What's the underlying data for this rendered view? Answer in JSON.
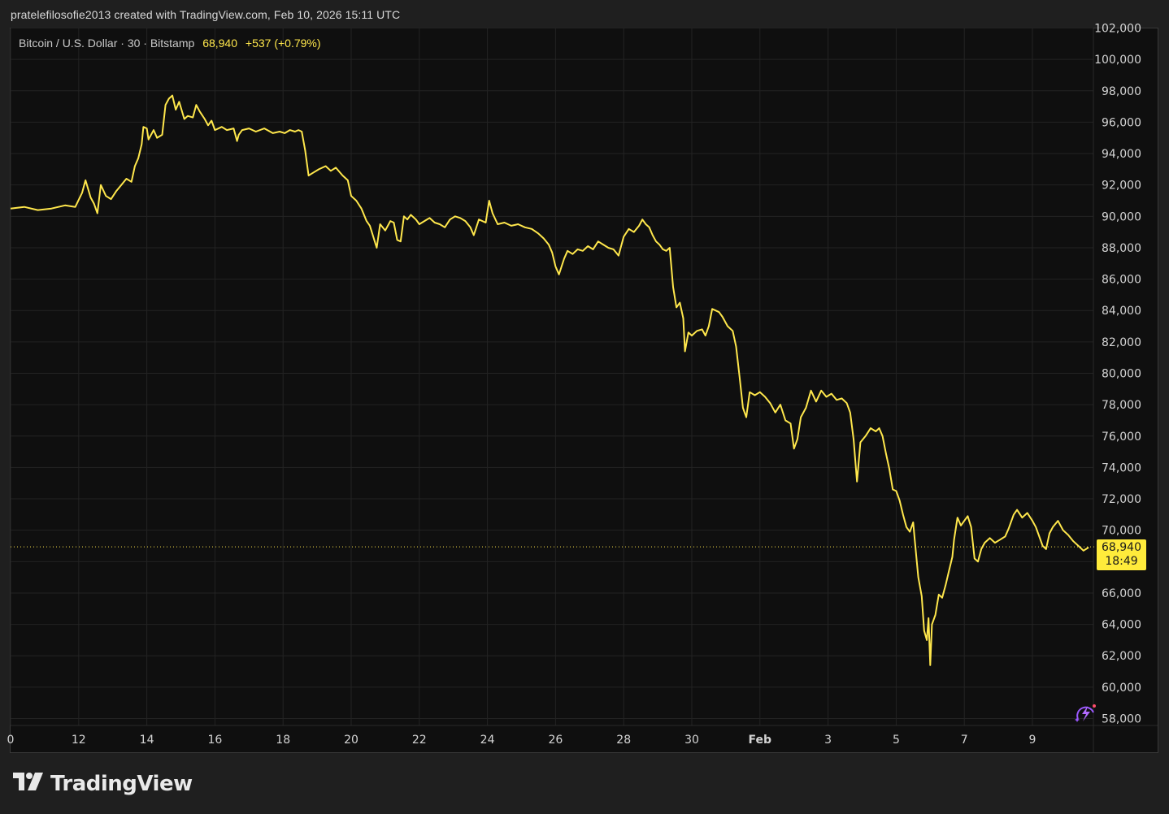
{
  "header": {
    "caption": "pratelefilosofie2013 created with TradingView.com, Feb 10, 2026 15:11 UTC"
  },
  "legend": {
    "symbol": "Bitcoin / U.S. Dollar · 30 · Bitstamp",
    "price": "68,940",
    "change": "+537 (+0.79%)"
  },
  "price_tag": {
    "price": "68,940",
    "countdown": "18:49"
  },
  "branding": {
    "logo_text": "TradingView"
  },
  "colors": {
    "background": "#0f0f0f",
    "grid": "#232323",
    "line": "#ffe74c",
    "axis_text": "#d4d4d4",
    "tag": "#ffeb3b"
  },
  "icons": [
    "tradingview-logo-icon",
    "lightning-icon"
  ],
  "chart_data": {
    "type": "line",
    "title": "",
    "xlabel": "",
    "ylabel": "",
    "ylim": [
      58000,
      102000
    ],
    "grid": true,
    "y_ticks": [
      58000,
      60000,
      62000,
      64000,
      66000,
      68000,
      70000,
      72000,
      74000,
      76000,
      78000,
      80000,
      82000,
      84000,
      86000,
      88000,
      90000,
      92000,
      94000,
      96000,
      98000,
      100000,
      102000
    ],
    "x_ticks": [
      {
        "day": 10,
        "label": "0"
      },
      {
        "day": 12,
        "label": "12"
      },
      {
        "day": 14,
        "label": "14"
      },
      {
        "day": 16,
        "label": "16"
      },
      {
        "day": 18,
        "label": "18"
      },
      {
        "day": 20,
        "label": "20"
      },
      {
        "day": 22,
        "label": "22"
      },
      {
        "day": 24,
        "label": "24"
      },
      {
        "day": 26,
        "label": "26"
      },
      {
        "day": 28,
        "label": "28"
      },
      {
        "day": 30,
        "label": "30"
      },
      {
        "day": 32,
        "label": "Feb"
      },
      {
        "day": 34,
        "label": "3"
      },
      {
        "day": 36,
        "label": "5"
      },
      {
        "day": 38,
        "label": "7"
      },
      {
        "day": 40,
        "label": "9"
      }
    ],
    "x_range": [
      10,
      41.8
    ],
    "last_price": 68940,
    "series": [
      {
        "values": [
          [
            10.0,
            90500
          ],
          [
            10.4,
            90600
          ],
          [
            10.8,
            90400
          ],
          [
            11.2,
            90500
          ],
          [
            11.6,
            90700
          ],
          [
            11.9,
            90600
          ],
          [
            12.1,
            91500
          ],
          [
            12.2,
            92300
          ],
          [
            12.35,
            91200
          ],
          [
            12.45,
            90800
          ],
          [
            12.55,
            90200
          ],
          [
            12.65,
            92000
          ],
          [
            12.8,
            91300
          ],
          [
            12.95,
            91100
          ],
          [
            13.1,
            91600
          ],
          [
            13.25,
            92000
          ],
          [
            13.4,
            92400
          ],
          [
            13.55,
            92200
          ],
          [
            13.65,
            93200
          ],
          [
            13.75,
            93700
          ],
          [
            13.85,
            94600
          ],
          [
            13.9,
            95700
          ],
          [
            14.0,
            95600
          ],
          [
            14.05,
            94900
          ],
          [
            14.2,
            95500
          ],
          [
            14.3,
            95000
          ],
          [
            14.45,
            95200
          ],
          [
            14.55,
            97100
          ],
          [
            14.65,
            97500
          ],
          [
            14.75,
            97700
          ],
          [
            14.85,
            96800
          ],
          [
            14.95,
            97300
          ],
          [
            15.1,
            96200
          ],
          [
            15.2,
            96400
          ],
          [
            15.35,
            96300
          ],
          [
            15.45,
            97100
          ],
          [
            15.55,
            96700
          ],
          [
            15.7,
            96200
          ],
          [
            15.8,
            95800
          ],
          [
            15.9,
            96100
          ],
          [
            16.0,
            95500
          ],
          [
            16.2,
            95700
          ],
          [
            16.35,
            95500
          ],
          [
            16.55,
            95600
          ],
          [
            16.65,
            94800
          ],
          [
            16.7,
            95200
          ],
          [
            16.8,
            95500
          ],
          [
            17.0,
            95600
          ],
          [
            17.2,
            95400
          ],
          [
            17.45,
            95600
          ],
          [
            17.7,
            95300
          ],
          [
            17.9,
            95400
          ],
          [
            18.05,
            95300
          ],
          [
            18.2,
            95500
          ],
          [
            18.35,
            95400
          ],
          [
            18.45,
            95500
          ],
          [
            18.55,
            95400
          ],
          [
            18.65,
            94200
          ],
          [
            18.75,
            92600
          ],
          [
            18.9,
            92800
          ],
          [
            19.05,
            93000
          ],
          [
            19.25,
            93200
          ],
          [
            19.4,
            92900
          ],
          [
            19.55,
            93100
          ],
          [
            19.75,
            92600
          ],
          [
            19.9,
            92300
          ],
          [
            20.0,
            91300
          ],
          [
            20.15,
            91000
          ],
          [
            20.3,
            90500
          ],
          [
            20.45,
            89700
          ],
          [
            20.55,
            89400
          ],
          [
            20.65,
            88700
          ],
          [
            20.75,
            88000
          ],
          [
            20.85,
            89500
          ],
          [
            21.0,
            89100
          ],
          [
            21.15,
            89700
          ],
          [
            21.25,
            89600
          ],
          [
            21.35,
            88500
          ],
          [
            21.45,
            88400
          ],
          [
            21.55,
            90000
          ],
          [
            21.65,
            89800
          ],
          [
            21.75,
            90100
          ],
          [
            21.9,
            89800
          ],
          [
            22.0,
            89500
          ],
          [
            22.15,
            89700
          ],
          [
            22.3,
            89900
          ],
          [
            22.45,
            89600
          ],
          [
            22.6,
            89500
          ],
          [
            22.75,
            89300
          ],
          [
            22.9,
            89800
          ],
          [
            23.05,
            90000
          ],
          [
            23.2,
            89900
          ],
          [
            23.35,
            89700
          ],
          [
            23.5,
            89300
          ],
          [
            23.6,
            88800
          ],
          [
            23.75,
            89800
          ],
          [
            23.95,
            89600
          ],
          [
            24.05,
            91000
          ],
          [
            24.15,
            90200
          ],
          [
            24.3,
            89500
          ],
          [
            24.5,
            89600
          ],
          [
            24.7,
            89400
          ],
          [
            24.9,
            89500
          ],
          [
            25.1,
            89300
          ],
          [
            25.3,
            89200
          ],
          [
            25.5,
            88900
          ],
          [
            25.65,
            88600
          ],
          [
            25.8,
            88200
          ],
          [
            25.9,
            87700
          ],
          [
            26.0,
            86800
          ],
          [
            26.1,
            86300
          ],
          [
            26.25,
            87300
          ],
          [
            26.35,
            87800
          ],
          [
            26.5,
            87600
          ],
          [
            26.65,
            87900
          ],
          [
            26.8,
            87800
          ],
          [
            26.95,
            88100
          ],
          [
            27.1,
            87900
          ],
          [
            27.25,
            88400
          ],
          [
            27.4,
            88200
          ],
          [
            27.55,
            88000
          ],
          [
            27.7,
            87900
          ],
          [
            27.85,
            87500
          ],
          [
            28.0,
            88700
          ],
          [
            28.15,
            89200
          ],
          [
            28.3,
            89000
          ],
          [
            28.45,
            89400
          ],
          [
            28.55,
            89800
          ],
          [
            28.65,
            89500
          ],
          [
            28.75,
            89300
          ],
          [
            28.85,
            88800
          ],
          [
            28.95,
            88400
          ],
          [
            29.05,
            88200
          ],
          [
            29.15,
            87900
          ],
          [
            29.25,
            87800
          ],
          [
            29.35,
            88000
          ],
          [
            29.45,
            85500
          ],
          [
            29.55,
            84200
          ],
          [
            29.65,
            84500
          ],
          [
            29.75,
            83500
          ],
          [
            29.8,
            81400
          ],
          [
            29.9,
            82600
          ],
          [
            30.0,
            82400
          ],
          [
            30.15,
            82700
          ],
          [
            30.3,
            82800
          ],
          [
            30.4,
            82400
          ],
          [
            30.5,
            83000
          ],
          [
            30.6,
            84100
          ],
          [
            30.7,
            84000
          ],
          [
            30.8,
            83900
          ],
          [
            30.9,
            83600
          ],
          [
            31.05,
            83000
          ],
          [
            31.2,
            82700
          ],
          [
            31.3,
            81700
          ],
          [
            31.4,
            79800
          ],
          [
            31.5,
            77800
          ],
          [
            31.6,
            77200
          ],
          [
            31.7,
            78800
          ],
          [
            31.85,
            78600
          ],
          [
            32.0,
            78800
          ],
          [
            32.15,
            78500
          ],
          [
            32.3,
            78100
          ],
          [
            32.45,
            77500
          ],
          [
            32.6,
            78000
          ],
          [
            32.75,
            77000
          ],
          [
            32.9,
            76800
          ],
          [
            33.0,
            75200
          ],
          [
            33.1,
            75800
          ],
          [
            33.2,
            77200
          ],
          [
            33.35,
            77800
          ],
          [
            33.5,
            78900
          ],
          [
            33.65,
            78200
          ],
          [
            33.8,
            78900
          ],
          [
            33.95,
            78500
          ],
          [
            34.1,
            78700
          ],
          [
            34.25,
            78300
          ],
          [
            34.4,
            78400
          ],
          [
            34.55,
            78100
          ],
          [
            34.65,
            77500
          ],
          [
            34.75,
            75800
          ],
          [
            34.85,
            73100
          ],
          [
            34.95,
            75600
          ],
          [
            35.1,
            76000
          ],
          [
            35.25,
            76500
          ],
          [
            35.4,
            76300
          ],
          [
            35.5,
            76500
          ],
          [
            35.6,
            76000
          ],
          [
            35.7,
            74900
          ],
          [
            35.8,
            73900
          ],
          [
            35.9,
            72600
          ],
          [
            36.0,
            72500
          ],
          [
            36.1,
            71900
          ],
          [
            36.2,
            71000
          ],
          [
            36.3,
            70200
          ],
          [
            36.4,
            69900
          ],
          [
            36.5,
            70500
          ],
          [
            36.55,
            69300
          ],
          [
            36.65,
            67000
          ],
          [
            36.75,
            65800
          ],
          [
            36.82,
            63600
          ],
          [
            36.9,
            63000
          ],
          [
            36.95,
            64400
          ],
          [
            37.0,
            61400
          ],
          [
            37.05,
            64000
          ],
          [
            37.15,
            64600
          ],
          [
            37.25,
            65900
          ],
          [
            37.35,
            65700
          ],
          [
            37.45,
            66500
          ],
          [
            37.55,
            67400
          ],
          [
            37.65,
            68300
          ],
          [
            37.7,
            69400
          ],
          [
            37.8,
            70800
          ],
          [
            37.9,
            70300
          ],
          [
            38.0,
            70600
          ],
          [
            38.1,
            70900
          ],
          [
            38.2,
            70200
          ],
          [
            38.3,
            68200
          ],
          [
            38.4,
            68000
          ],
          [
            38.5,
            68800
          ],
          [
            38.6,
            69200
          ],
          [
            38.75,
            69500
          ],
          [
            38.9,
            69200
          ],
          [
            39.05,
            69400
          ],
          [
            39.2,
            69600
          ],
          [
            39.3,
            70100
          ],
          [
            39.45,
            71000
          ],
          [
            39.55,
            71300
          ],
          [
            39.7,
            70800
          ],
          [
            39.85,
            71100
          ],
          [
            40.0,
            70600
          ],
          [
            40.1,
            70200
          ],
          [
            40.2,
            69600
          ],
          [
            40.3,
            69000
          ],
          [
            40.4,
            68800
          ],
          [
            40.5,
            69800
          ],
          [
            40.6,
            70200
          ],
          [
            40.75,
            70600
          ],
          [
            40.9,
            70000
          ],
          [
            41.05,
            69700
          ],
          [
            41.2,
            69300
          ],
          [
            41.35,
            69000
          ],
          [
            41.5,
            68700
          ],
          [
            41.65,
            68900
          ]
        ]
      }
    ]
  }
}
